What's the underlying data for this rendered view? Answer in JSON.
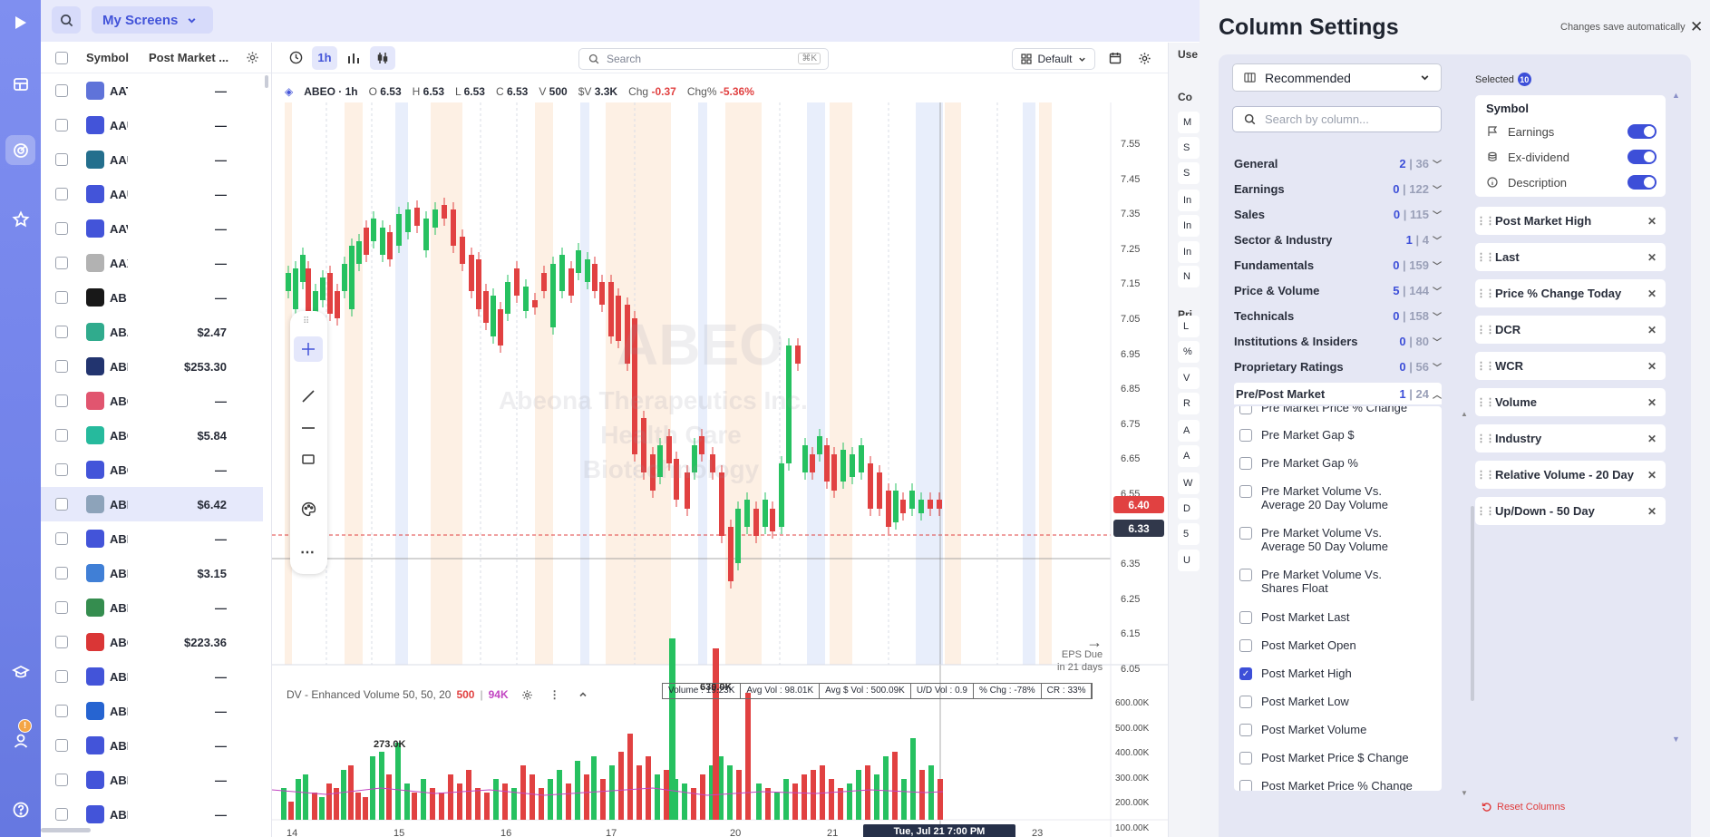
{
  "topbar": {
    "screen_label": "My Screens"
  },
  "list": {
    "header": {
      "symbol": "Symbol",
      "post_market": "Post Market ..."
    },
    "rows": [
      {
        "symbol": "AAT",
        "value": "—",
        "logo": "#5a6fd8"
      },
      {
        "symbol": "AAU",
        "value": "—",
        "logo": "#3d4fd8"
      },
      {
        "symbol": "AAU",
        "value": "—",
        "logo": "#1d6b8a"
      },
      {
        "symbol": "AAU",
        "value": "—",
        "logo": "#3d4fd8"
      },
      {
        "symbol": "AAV",
        "value": "—",
        "logo": "#3d4fd8"
      },
      {
        "symbol": "AAX",
        "value": "—",
        "logo": "#b0b0b0"
      },
      {
        "symbol": "AB",
        "value": "—",
        "logo": "#111111"
      },
      {
        "symbol": "ABA",
        "value": "$2.47",
        "logo": "#2aa98a"
      },
      {
        "symbol": "ABB",
        "value": "$253.30",
        "logo": "#1b2e6b"
      },
      {
        "symbol": "ABC",
        "value": "—",
        "logo": "#e0506b"
      },
      {
        "symbol": "ABC",
        "value": "$5.84",
        "logo": "#1fb89a"
      },
      {
        "symbol": "ABC",
        "value": "—",
        "logo": "#3d4fd8"
      },
      {
        "symbol": "ABE",
        "value": "$6.42",
        "logo": "#8aa0b8"
      },
      {
        "symbol": "ABE",
        "value": "—",
        "logo": "#3d4fd8"
      },
      {
        "symbol": "ABE",
        "value": "$3.15",
        "logo": "#3a7bd5"
      },
      {
        "symbol": "ABF",
        "value": "—",
        "logo": "#2f8a4a"
      },
      {
        "symbol": "ABG",
        "value": "$223.36",
        "logo": "#d93030"
      },
      {
        "symbol": "ABI",
        "value": "—",
        "logo": "#3d4fd8"
      },
      {
        "symbol": "ABI",
        "value": "—",
        "logo": "#1f5fd0"
      },
      {
        "symbol": "ABL",
        "value": "—",
        "logo": "#3d4fd8"
      },
      {
        "symbol": "ABL",
        "value": "—",
        "logo": "#3d4fd8"
      },
      {
        "symbol": "ABL",
        "value": "—",
        "logo": "#3d4fd8"
      }
    ],
    "selected_index": 12
  },
  "nav": {
    "badge": "!"
  },
  "chart": {
    "interval": "1h",
    "search_placeholder": "Search",
    "search_kbd": "⌘K",
    "layout": "Default",
    "ohlc": {
      "symbol": "ABEO · 1h",
      "o_label": "O",
      "o": "6.53",
      "h_label": "H",
      "h": "6.53",
      "l_label": "L",
      "l": "6.53",
      "c_label": "C",
      "c": "6.53",
      "v_label": "V",
      "v": "500",
      "sv_label": "$V",
      "sv": "3.3K",
      "chg_label": "Chg",
      "chg": "-0.37",
      "chgp_label": "Chg%",
      "chgp": "-5.36%"
    },
    "watermark": {
      "symbol": "ABEO",
      "name": "Abeona Therapeutics Inc.",
      "sector": "Health Care",
      "industry": "Biotechnology"
    },
    "price_axis": [
      "7.55",
      "7.45",
      "7.35",
      "7.25",
      "7.15",
      "7.05",
      "6.95",
      "6.85",
      "6.75",
      "6.65",
      "6.55",
      "6.45",
      "6.35",
      "6.25",
      "6.15",
      "6.05"
    ],
    "last_price": "6.40",
    "cross_price": "6.33",
    "eps": {
      "line1": "EPS Due",
      "line2": "in 21 days"
    },
    "dv": {
      "label": "DV - Enhanced Volume 50, 50, 20",
      "v1": "500",
      "v2": "94K"
    },
    "dv_stats": [
      "Volume : 19.23K",
      "Avg Vol : 98.01K",
      "Avg $ Vol : 500.09K",
      "U/D Vol : 0.9",
      "% Chg : -78%",
      "CR : 33%"
    ],
    "vol_axis": [
      "600.00K",
      "500.00K",
      "400.00K",
      "300.00K",
      "200.00K",
      "100.00K"
    ],
    "vol_labels": {
      "peak1": "273.0K",
      "peak2": "630.0K"
    },
    "x_labels": [
      "14",
      "15",
      "16",
      "17",
      "20",
      "21",
      "23"
    ],
    "date_tag": "Tue, Jul 21 7:00 PM"
  },
  "strip": {
    "labels": [
      "Use",
      "Co",
      "Pri"
    ],
    "keys": [
      "M",
      "S",
      "S",
      "In",
      "In",
      "In",
      "N",
      "L",
      "%",
      "V",
      "R",
      "A",
      "A",
      "W",
      "D",
      "5",
      "U"
    ]
  },
  "panel": {
    "title": "Column Settings",
    "autosave": "Changes save automatically",
    "preset": "Recommended",
    "search_placeholder": "Search by column...",
    "categories": [
      {
        "name": "General",
        "sel": "2",
        "total": "36"
      },
      {
        "name": "Earnings",
        "sel": "0",
        "total": "122"
      },
      {
        "name": "Sales",
        "sel": "0",
        "total": "115"
      },
      {
        "name": "Sector & Industry",
        "sel": "1",
        "total": "4"
      },
      {
        "name": "Fundamentals",
        "sel": "0",
        "total": "159"
      },
      {
        "name": "Price & Volume",
        "sel": "5",
        "total": "144"
      },
      {
        "name": "Technicals",
        "sel": "0",
        "total": "158"
      },
      {
        "name": "Institutions & Insiders",
        "sel": "0",
        "total": "80"
      },
      {
        "name": "Proprietary Ratings",
        "sel": "0",
        "total": "56"
      },
      {
        "name": "Pre/Post Market",
        "sel": "1",
        "total": "24"
      }
    ],
    "options": [
      {
        "label": "Pre Market Price % Change",
        "checked": false
      },
      {
        "label": "Pre Market Gap $",
        "checked": false
      },
      {
        "label": "Pre Market Gap %",
        "checked": false
      },
      {
        "label": "Pre Market Volume Vs. Average 20 Day Volume",
        "checked": false
      },
      {
        "label": "Pre Market Volume Vs. Average 50 Day Volume",
        "checked": false
      },
      {
        "label": "Pre Market Volume Vs. Shares Float",
        "checked": false
      },
      {
        "label": "Post Market Last",
        "checked": false
      },
      {
        "label": "Post Market Open",
        "checked": false
      },
      {
        "label": "Post Market High",
        "checked": true
      },
      {
        "label": "Post Market Low",
        "checked": false
      },
      {
        "label": "Post Market Volume",
        "checked": false
      },
      {
        "label": "Post Market Price $ Change",
        "checked": false
      },
      {
        "label": "Post Market Price % Change",
        "checked": false
      }
    ],
    "selected_label": "Selected",
    "selected_count": "10",
    "symbol_card": {
      "title": "Symbol",
      "toggles": [
        "Earnings",
        "Ex-dividend",
        "Description"
      ]
    },
    "selected": [
      "Post Market High",
      "Last",
      "Price % Change Today",
      "DCR",
      "WCR",
      "Volume",
      "Industry",
      "Relative Volume - 20 Day",
      "Up/Down - 50 Day"
    ],
    "reset": "Reset Columns"
  }
}
